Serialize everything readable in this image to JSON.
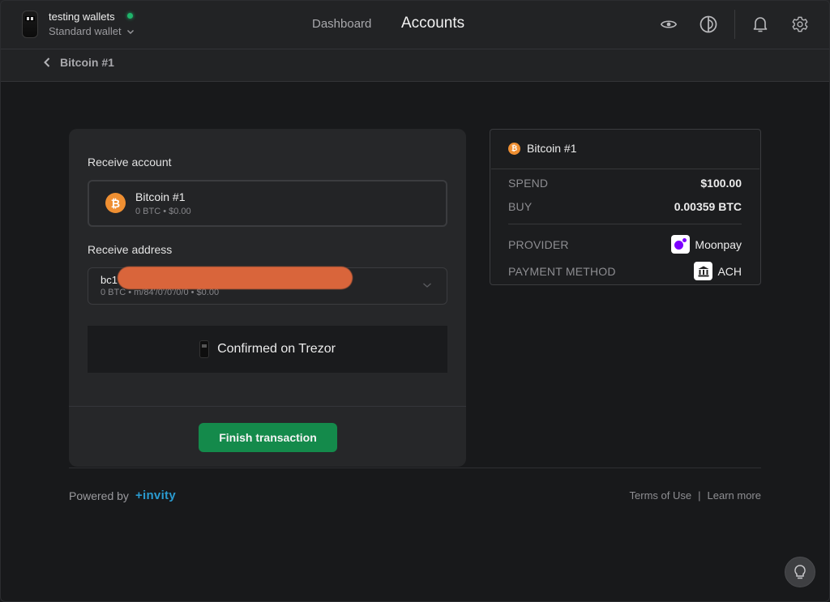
{
  "header": {
    "wallet_name": "testing wallets",
    "wallet_type": "Standard wallet",
    "status": "connected",
    "nav": [
      {
        "label": "Dashboard",
        "active": false
      },
      {
        "label": "Accounts",
        "active": true
      }
    ],
    "icons": [
      "eye-icon",
      "theme-icon",
      "bell-icon",
      "gear-icon"
    ]
  },
  "breadcrumb": {
    "back_icon": "chevron-left-icon",
    "title": "Bitcoin #1"
  },
  "receive": {
    "account_label": "Receive account",
    "account": {
      "icon": "bitcoin-icon",
      "name": "Bitcoin #1",
      "balance": "0 BTC • $0.00"
    },
    "address_label": "Receive address",
    "address": {
      "value": "bc1",
      "details": "0 BTC • m/84'/0'/0'/0/0 • $0.00",
      "redacted": true
    },
    "confirm_text": "Confirmed on Trezor",
    "finish_button": "Finish transaction"
  },
  "summary": {
    "account_name": "Bitcoin #1",
    "rows": [
      {
        "key": "SPEND",
        "value": "$100.00"
      },
      {
        "key": "BUY",
        "value": "0.00359 BTC"
      }
    ],
    "provider_label": "PROVIDER",
    "provider_value": "Moonpay",
    "payment_label": "PAYMENT METHOD",
    "payment_value": "ACH"
  },
  "footer": {
    "powered_by": "Powered by",
    "brand": "+invity",
    "terms": "Terms of Use",
    "separator": "|",
    "learn_more": "Learn more"
  },
  "colors": {
    "accent_green": "#148a4b",
    "bitcoin_orange": "#ef8f32",
    "status_green": "#1fb56b",
    "invity_blue": "#2a9bd0",
    "moonpay_purple": "#7d00ff"
  }
}
